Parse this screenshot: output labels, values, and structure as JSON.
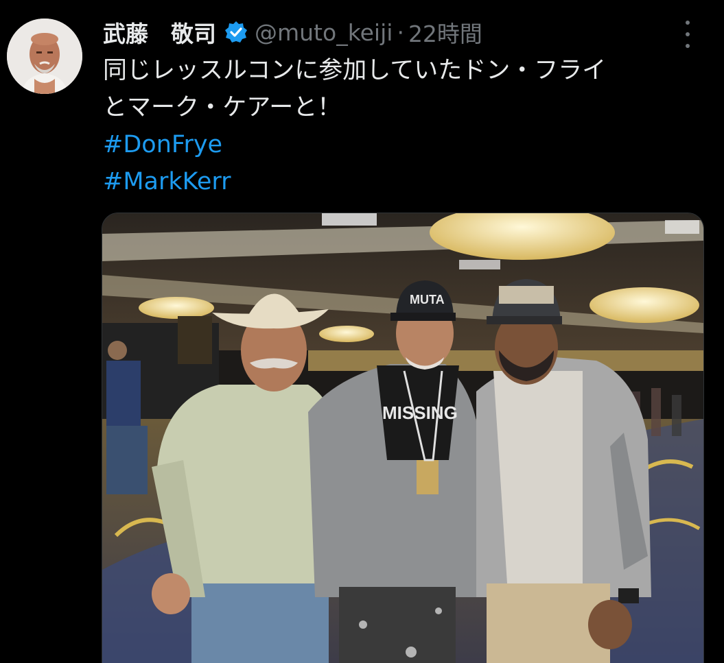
{
  "tweet": {
    "author_name": "武藤　敬司",
    "handle": "@muto_keiji",
    "separator": "·",
    "time": "22時間",
    "text_lines": [
      "同じレッスルコンに参加していたドン・フライ",
      "とマーク・ケアーと！"
    ],
    "hashtags": [
      "#DonFrye",
      "#MarkKerr"
    ]
  },
  "icons": {
    "verified": "verified-badge-icon",
    "more": "more-options-icon"
  },
  "colors": {
    "background": "#000000",
    "text": "#e7e9ea",
    "muted": "#71767b",
    "link": "#1d9bf0",
    "verified": "#1d9bf0"
  },
  "photo": {
    "cap_text": "MUTA",
    "shirt_text": "MISSING"
  }
}
